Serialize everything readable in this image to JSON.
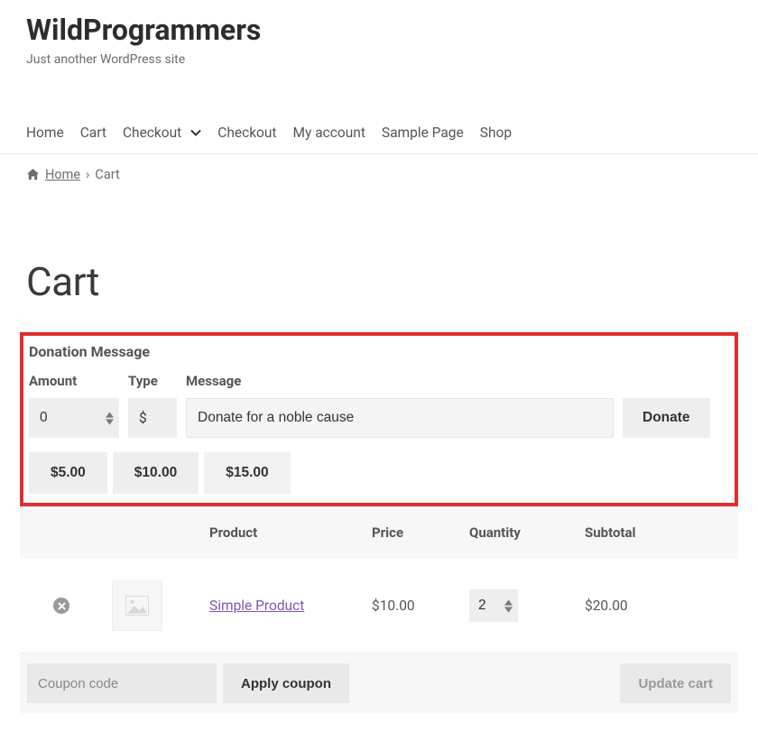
{
  "site": {
    "title": "WildProgrammers",
    "tagline": "Just another WordPress site"
  },
  "nav": {
    "items": [
      {
        "label": "Home",
        "has_submenu": false
      },
      {
        "label": "Cart",
        "has_submenu": false
      },
      {
        "label": "Checkout",
        "has_submenu": true
      },
      {
        "label": "Checkout",
        "has_submenu": false
      },
      {
        "label": "My account",
        "has_submenu": false
      },
      {
        "label": "Sample Page",
        "has_submenu": false
      },
      {
        "label": "Shop",
        "has_submenu": false
      }
    ]
  },
  "breadcrumb": {
    "home": "Home",
    "current": "Cart"
  },
  "page_title": "Cart",
  "donation": {
    "title": "Donation Message",
    "labels": {
      "amount": "Amount",
      "type": "Type",
      "message": "Message"
    },
    "amount_value": "0",
    "type_value": "$",
    "message_value": "Donate for a noble cause",
    "button": "Donate",
    "presets": [
      "$5.00",
      "$10.00",
      "$15.00"
    ]
  },
  "cart_table": {
    "headers": {
      "product": "Product",
      "price": "Price",
      "quantity": "Quantity",
      "subtotal": "Subtotal"
    },
    "rows": [
      {
        "product": "Simple Product",
        "price": "$10.00",
        "quantity": "2",
        "subtotal": "$20.00"
      }
    ]
  },
  "actions": {
    "coupon_placeholder": "Coupon code",
    "apply_coupon": "Apply coupon",
    "update_cart": "Update cart"
  }
}
